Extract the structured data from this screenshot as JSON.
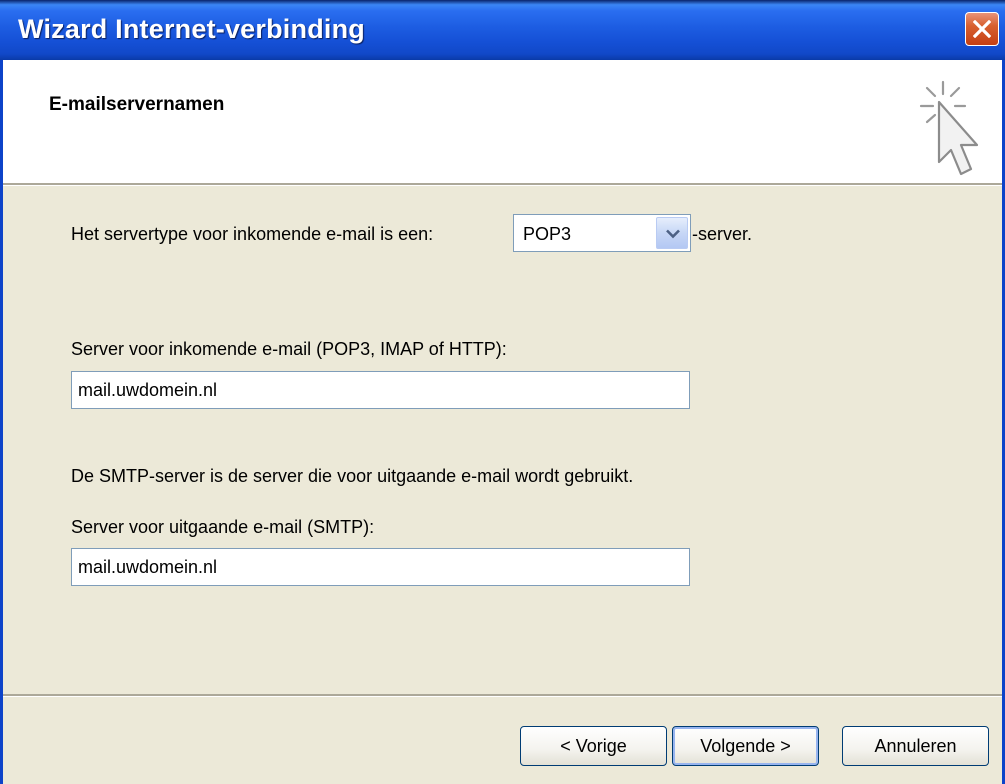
{
  "window": {
    "title": "Wizard Internet-verbinding"
  },
  "header": {
    "title": "E-mailservernamen",
    "icon": "wizard-cursor-icon"
  },
  "server_type": {
    "label": "Het servertype voor inkomende e-mail is een:",
    "selected": "POP3",
    "suffix": "-server."
  },
  "incoming": {
    "label": "Server voor inkomende e-mail (POP3, IMAP of HTTP):",
    "value": "mail.uwdomein.nl"
  },
  "smtp_info": "De SMTP-server is de server die voor uitgaande e-mail wordt gebruikt.",
  "outgoing": {
    "label": "Server voor uitgaande e-mail (SMTP):",
    "value": "mail.uwdomein.nl"
  },
  "buttons": {
    "back": "< Vorige",
    "next": "Volgende >",
    "cancel": "Annuleren"
  },
  "colors": {
    "titlebar": "#1d5de2",
    "dialog_bg": "#ece9d8",
    "close": "#d8602f"
  }
}
